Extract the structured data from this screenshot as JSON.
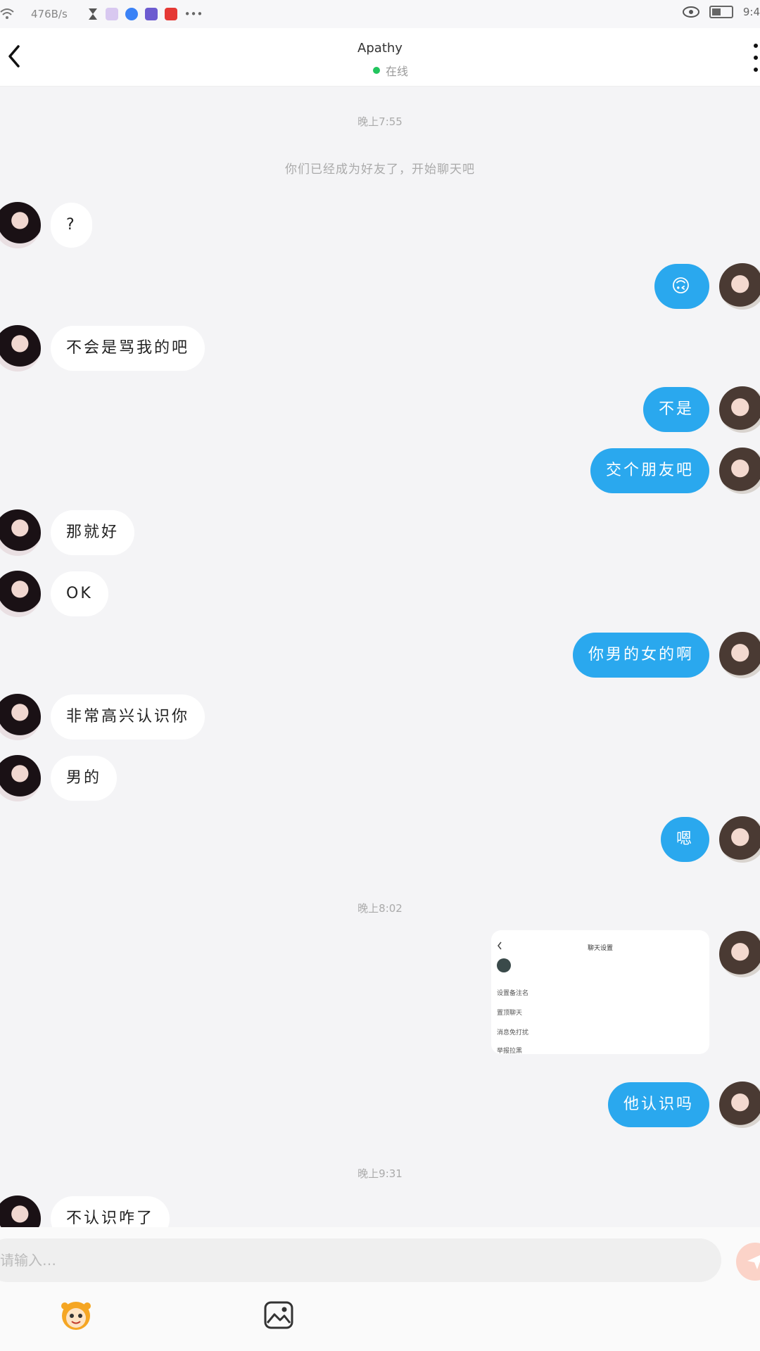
{
  "status_bar": {
    "speed": "476B/s",
    "time": "9:4"
  },
  "header": {
    "title": "Apathy",
    "status": "在线"
  },
  "timestamps": [
    "晚上7:55",
    "晚上8:02",
    "晚上9:31"
  ],
  "system_notice": "你们已经成为好友了，开始聊天吧",
  "messages": {
    "m1": "?",
    "m2": "🙃",
    "m3": "不会是骂我的吧",
    "m4": "不是",
    "m5": "交个朋友吧",
    "m6": "那就好",
    "m7": "OK",
    "m8": "你男的女的啊",
    "m9": "非常高兴认识你",
    "m10": "男的",
    "m11": "嗯",
    "m13": "他认识吗",
    "m14": "不认识咋了"
  },
  "screenshot_card": {
    "title": "聊天设置",
    "rows": [
      "设置备注名",
      "置顶聊天",
      "消息免打扰",
      "举报拉黑"
    ]
  },
  "input": {
    "placeholder": "请输入…"
  },
  "colors": {
    "accent": "#2aa8ee",
    "bubble_left": "#ffffff",
    "background": "#f4f4f6",
    "online": "#22c55e"
  },
  "icons": [
    "wifi-icon",
    "hourglass-icon",
    "eye-icon",
    "battery-icon",
    "back-arrow-icon",
    "more-icon",
    "emoji-icon",
    "image-icon",
    "send-icon"
  ]
}
